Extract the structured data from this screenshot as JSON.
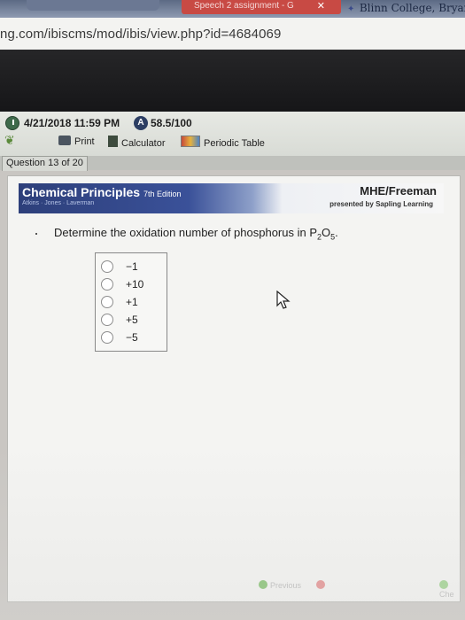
{
  "browser": {
    "active_tab_title": "Speech 2 assignment - G",
    "right_tab_title": "Blinn College, Bryan",
    "url": "ng.com/ibiscms/mod/ibis/view.php?id=4684069"
  },
  "header": {
    "due_date": "4/21/2018 11:59 PM",
    "score": "58.5/100",
    "score_badge": "A"
  },
  "tools": {
    "print": "Print",
    "calculator": "Calculator",
    "periodic_table": "Periodic Table"
  },
  "question_tab": "Question 13 of 20",
  "banner": {
    "title": "Chemical Principles",
    "edition": "7th Edition",
    "authors": "Atkins · Jones · Laverman",
    "publisher": "MHE/Freeman",
    "presented_by": "presented by Sapling Learning"
  },
  "question": {
    "prefix": "Determine the oxidation number of phosphorus in P",
    "sub1": "2",
    "mid": "O",
    "sub2": "5",
    "suffix": "."
  },
  "choices": [
    "−1",
    "+10",
    "+1",
    "+5",
    "−5"
  ],
  "footer": {
    "previous": "Previous",
    "check": "Che"
  }
}
